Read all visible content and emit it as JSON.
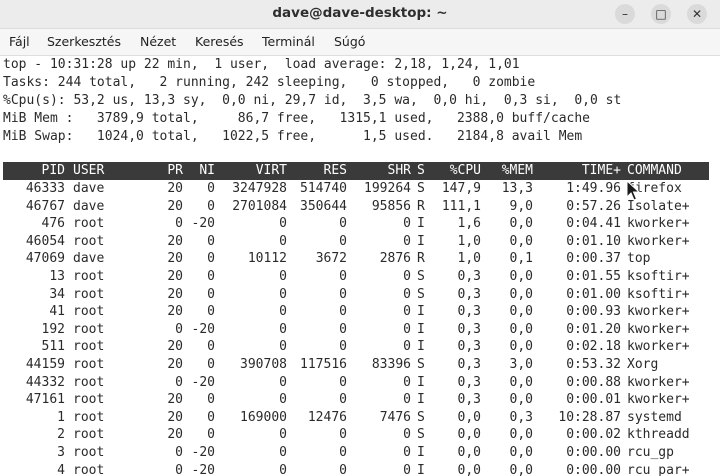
{
  "window": {
    "title": "dave@dave-desktop: ~",
    "minimize_glyph": "–",
    "maximize_glyph": "□",
    "close_glyph": "✕"
  },
  "menu": [
    "Fájl",
    "Szerkesztés",
    "Nézet",
    "Keresés",
    "Terminál",
    "Súgó"
  ],
  "summary": [
    "top - 10:31:28 up 22 min,  1 user,  load average: 2,18, 1,24, 1,01",
    "Tasks: 244 total,   2 running, 242 sleeping,   0 stopped,   0 zombie",
    "%Cpu(s): 53,2 us, 13,3 sy,  0,0 ni, 29,7 id,  3,5 wa,  0,0 hi,  0,3 si,  0,0 st",
    "MiB Mem :   3789,9 total,     86,7 free,   1315,1 used,   2388,0 buff/cache",
    "MiB Swap:   1024,0 total,   1022,5 free,      1,5 used.   2184,8 avail Mem"
  ],
  "columns": [
    "PID",
    "USER",
    "PR",
    "NI",
    "VIRT",
    "RES",
    "SHR",
    "S",
    "%CPU",
    "%MEM",
    "TIME+",
    "COMMAND"
  ],
  "processes": [
    {
      "pid": "46333",
      "user": "dave",
      "pr": "20",
      "ni": "0",
      "virt": "3247928",
      "res": "514740",
      "shr": "199264",
      "s": "S",
      "cpu": "147,9",
      "mem": "13,3",
      "time": "1:49.96",
      "cmd": "firefox"
    },
    {
      "pid": "46767",
      "user": "dave",
      "pr": "20",
      "ni": "0",
      "virt": "2701084",
      "res": "350644",
      "shr": "95856",
      "s": "R",
      "cpu": "111,1",
      "mem": "9,0",
      "time": "0:57.26",
      "cmd": "Isolate+"
    },
    {
      "pid": "476",
      "user": "root",
      "pr": "0",
      "ni": "-20",
      "virt": "0",
      "res": "0",
      "shr": "0",
      "s": "I",
      "cpu": "1,6",
      "mem": "0,0",
      "time": "0:04.41",
      "cmd": "kworker+"
    },
    {
      "pid": "46054",
      "user": "root",
      "pr": "20",
      "ni": "0",
      "virt": "0",
      "res": "0",
      "shr": "0",
      "s": "I",
      "cpu": "1,0",
      "mem": "0,0",
      "time": "0:01.10",
      "cmd": "kworker+"
    },
    {
      "pid": "47069",
      "user": "dave",
      "pr": "20",
      "ni": "0",
      "virt": "10112",
      "res": "3672",
      "shr": "2876",
      "s": "R",
      "cpu": "1,0",
      "mem": "0,1",
      "time": "0:00.37",
      "cmd": "top"
    },
    {
      "pid": "13",
      "user": "root",
      "pr": "20",
      "ni": "0",
      "virt": "0",
      "res": "0",
      "shr": "0",
      "s": "S",
      "cpu": "0,3",
      "mem": "0,0",
      "time": "0:01.55",
      "cmd": "ksoftir+"
    },
    {
      "pid": "34",
      "user": "root",
      "pr": "20",
      "ni": "0",
      "virt": "0",
      "res": "0",
      "shr": "0",
      "s": "S",
      "cpu": "0,3",
      "mem": "0,0",
      "time": "0:01.00",
      "cmd": "ksoftir+"
    },
    {
      "pid": "41",
      "user": "root",
      "pr": "20",
      "ni": "0",
      "virt": "0",
      "res": "0",
      "shr": "0",
      "s": "I",
      "cpu": "0,3",
      "mem": "0,0",
      "time": "0:00.93",
      "cmd": "kworker+"
    },
    {
      "pid": "192",
      "user": "root",
      "pr": "0",
      "ni": "-20",
      "virt": "0",
      "res": "0",
      "shr": "0",
      "s": "I",
      "cpu": "0,3",
      "mem": "0,0",
      "time": "0:01.20",
      "cmd": "kworker+"
    },
    {
      "pid": "511",
      "user": "root",
      "pr": "20",
      "ni": "0",
      "virt": "0",
      "res": "0",
      "shr": "0",
      "s": "I",
      "cpu": "0,3",
      "mem": "0,0",
      "time": "0:02.18",
      "cmd": "kworker+"
    },
    {
      "pid": "44159",
      "user": "root",
      "pr": "20",
      "ni": "0",
      "virt": "390708",
      "res": "117516",
      "shr": "83396",
      "s": "S",
      "cpu": "0,3",
      "mem": "3,0",
      "time": "0:53.32",
      "cmd": "Xorg"
    },
    {
      "pid": "44332",
      "user": "root",
      "pr": "0",
      "ni": "-20",
      "virt": "0",
      "res": "0",
      "shr": "0",
      "s": "I",
      "cpu": "0,3",
      "mem": "0,0",
      "time": "0:00.88",
      "cmd": "kworker+"
    },
    {
      "pid": "47161",
      "user": "root",
      "pr": "20",
      "ni": "0",
      "virt": "0",
      "res": "0",
      "shr": "0",
      "s": "I",
      "cpu": "0,3",
      "mem": "0,0",
      "time": "0:00.01",
      "cmd": "kworker+"
    },
    {
      "pid": "1",
      "user": "root",
      "pr": "20",
      "ni": "0",
      "virt": "169000",
      "res": "12476",
      "shr": "7476",
      "s": "S",
      "cpu": "0,0",
      "mem": "0,3",
      "time": "10:28.87",
      "cmd": "systemd"
    },
    {
      "pid": "2",
      "user": "root",
      "pr": "20",
      "ni": "0",
      "virt": "0",
      "res": "0",
      "shr": "0",
      "s": "S",
      "cpu": "0,0",
      "mem": "0,0",
      "time": "0:00.02",
      "cmd": "kthreadd"
    },
    {
      "pid": "3",
      "user": "root",
      "pr": "0",
      "ni": "-20",
      "virt": "0",
      "res": "0",
      "shr": "0",
      "s": "I",
      "cpu": "0,0",
      "mem": "0,0",
      "time": "0:00.00",
      "cmd": "rcu_gp"
    },
    {
      "pid": "4",
      "user": "root",
      "pr": "0",
      "ni": "-20",
      "virt": "0",
      "res": "0",
      "shr": "0",
      "s": "I",
      "cpu": "0,0",
      "mem": "0,0",
      "time": "0:00.00",
      "cmd": "rcu_par+"
    }
  ],
  "colors": {
    "header_bg": "#3a3a3a",
    "header_fg": "#ffffff",
    "text": "#2a2a2a"
  },
  "icons": {
    "cursor": "mouse-pointer-icon"
  }
}
